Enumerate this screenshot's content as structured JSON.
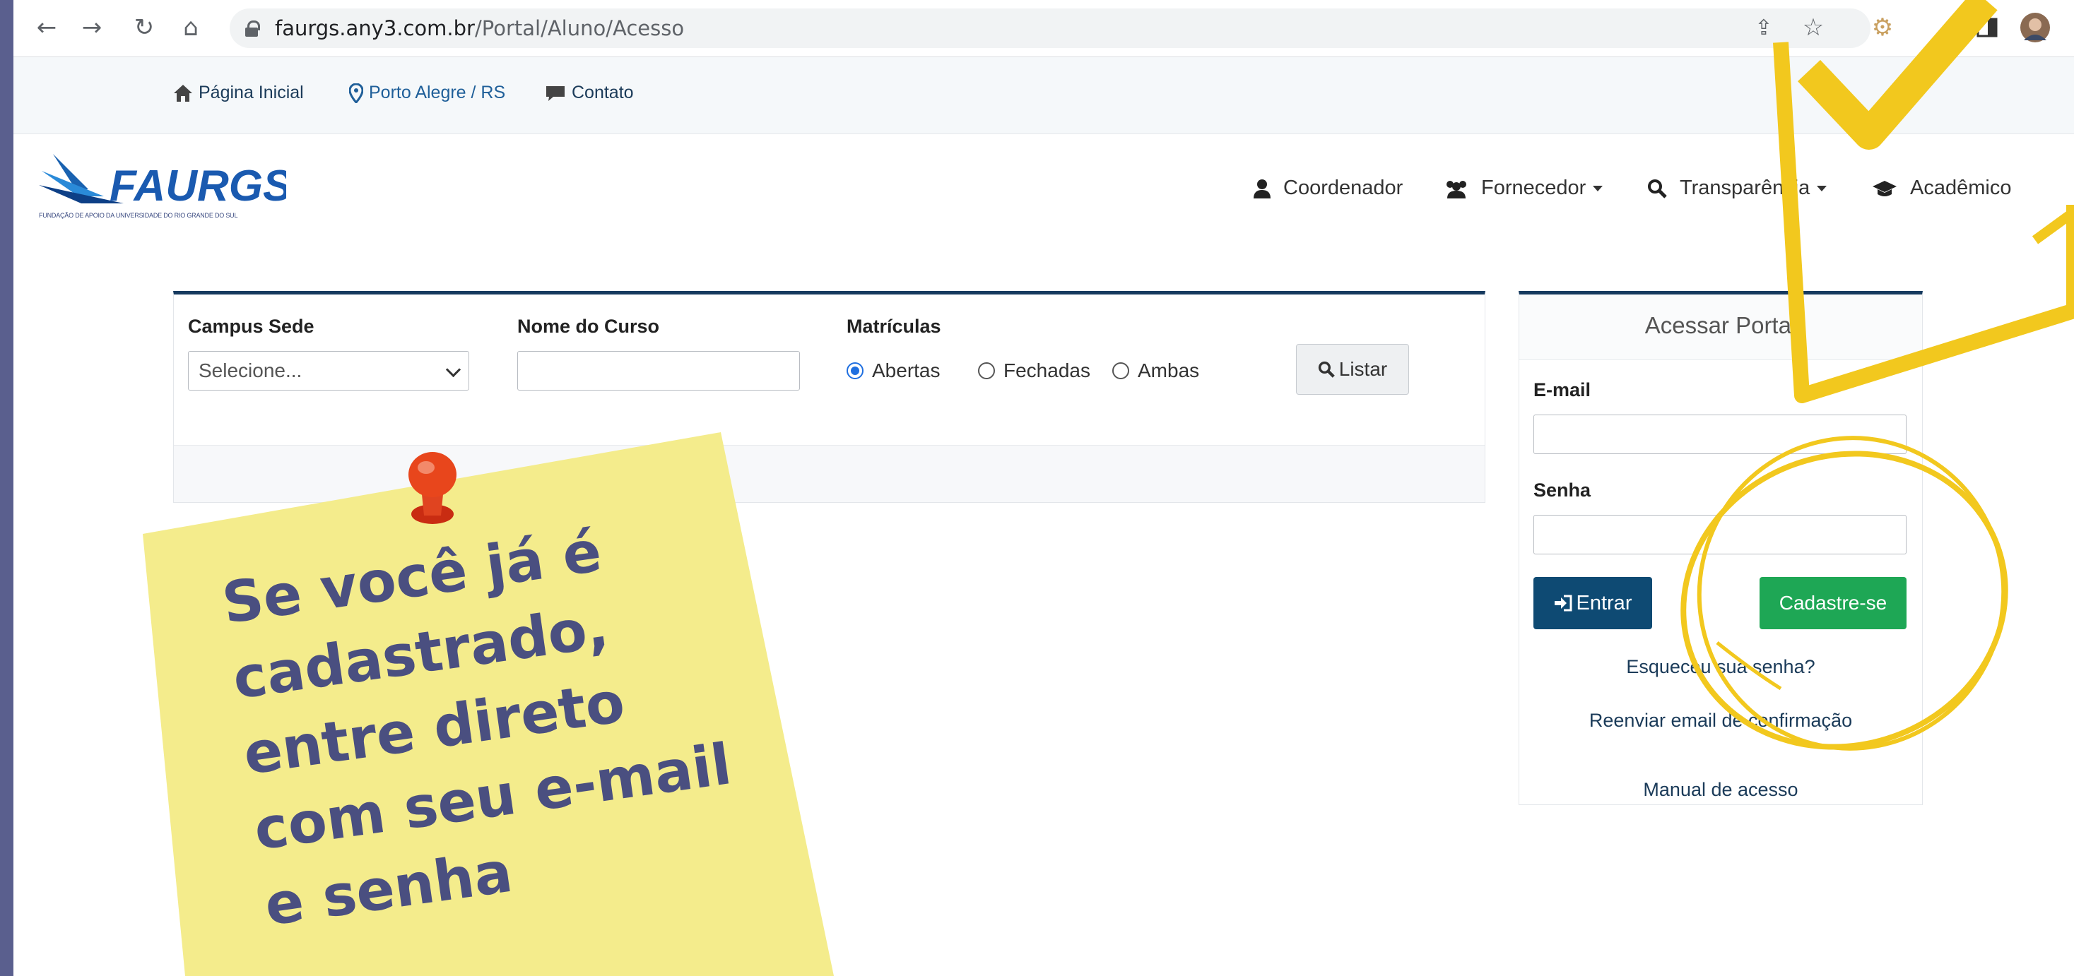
{
  "browser": {
    "url_host": "faurgs.any3.com.br",
    "url_path": "/Portal/Aluno/Acesso"
  },
  "topbar": {
    "home": "Página Inicial",
    "location": "Porto Alegre / RS",
    "contact": "Contato"
  },
  "logo": {
    "name": "FAURGS",
    "subtitle": "FUNDAÇÃO DE APOIO DA UNIVERSIDADE DO RIO GRANDE DO SUL"
  },
  "menu": {
    "coordenador": "Coordenador",
    "fornecedor": "Fornecedor",
    "transparencia": "Transparência",
    "academico": "Acadêmico"
  },
  "filter": {
    "campus_label": "Campus Sede",
    "campus_value": "Selecione...",
    "course_label": "Nome do Curso",
    "course_value": "",
    "enroll_label": "Matrículas",
    "opt_open": "Abertas",
    "opt_closed": "Fechadas",
    "opt_both": "Ambas",
    "selected": "Abertas",
    "list_button": "Listar"
  },
  "login": {
    "title": "Acessar Portal",
    "email_label": "E-mail",
    "email_value": "",
    "password_label": "Senha",
    "password_value": "",
    "enter_button": "Entrar",
    "signup_button": "Cadastre-se",
    "forgot": "Esqueceu sua senha?",
    "resend": "Reenviar email de confirmação",
    "manual": "Manual de acesso"
  },
  "note": {
    "line1": "Se você já é",
    "line2": "cadastrado,",
    "line3": "entre direto",
    "line4": "com seu e-mail",
    "line5": "e senha"
  },
  "colors": {
    "primary": "#0e4a73",
    "success": "#1ea755",
    "highlight": "#f2c81e",
    "note": "#f4ec8c"
  }
}
